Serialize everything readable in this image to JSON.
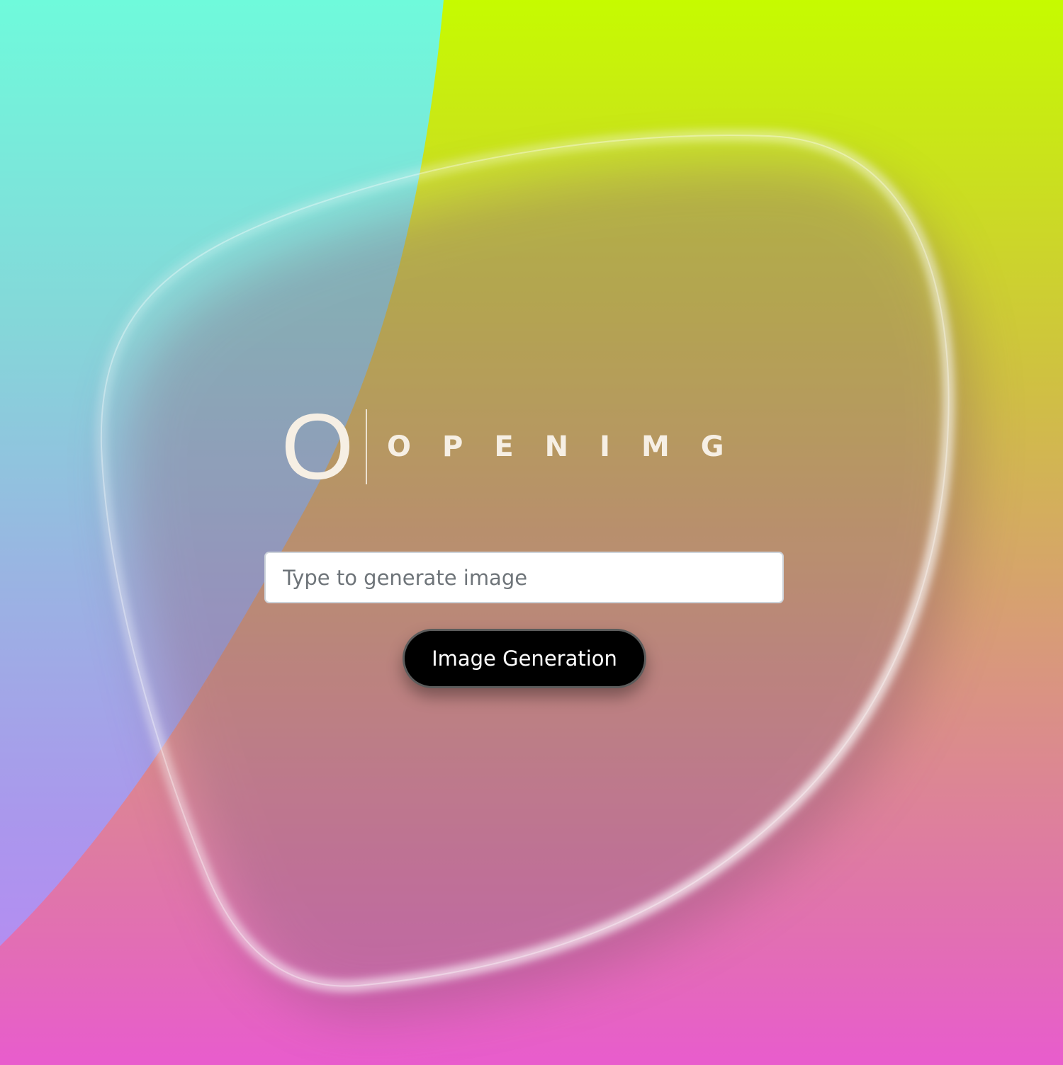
{
  "brand": {
    "logo_mark": "O",
    "wordmark": "OPENIMG"
  },
  "prompt": {
    "placeholder": "Type to generate image",
    "value": ""
  },
  "actions": {
    "generate_label": "Image Generation"
  },
  "colors": {
    "cyan_top": "#6ffadb",
    "lime_top": "#c6fb00",
    "magenta_bottom": "#e85ccd",
    "logo_cream": "#f6efe4",
    "button_black": "#000000"
  }
}
